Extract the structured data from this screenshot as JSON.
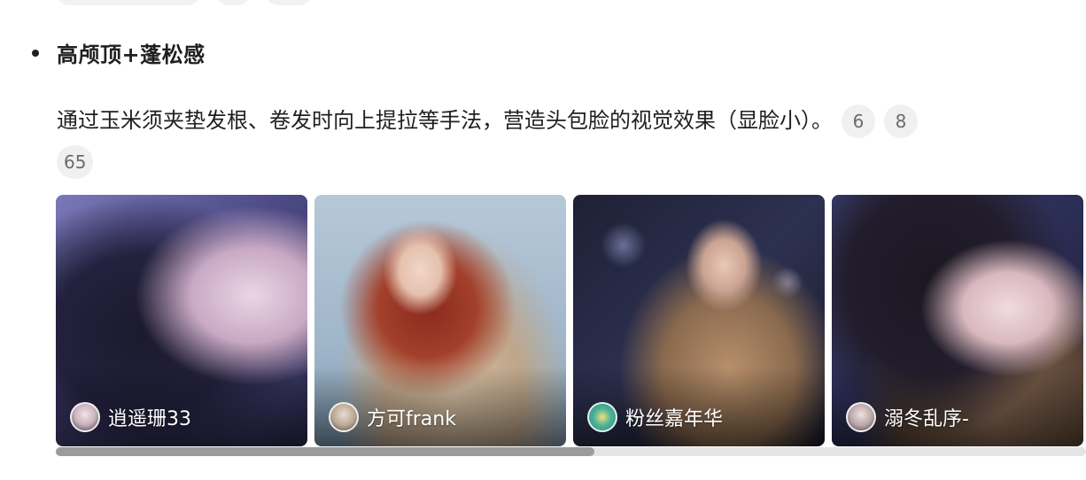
{
  "section": {
    "heading": "高颅顶+蓬松感",
    "paragraph": "通过玉米须夹垫发根、卷发时向上提拉等手法，营造头包脸的视觉效果（显脸小）。",
    "refs": [
      "6",
      "8",
      "65"
    ]
  },
  "gallery": {
    "cards": [
      {
        "username": "逍遥珊33",
        "avatar_icon": "user-avatar-icon"
      },
      {
        "username": "方可frank",
        "avatar_icon": "user-avatar-icon"
      },
      {
        "username": "粉丝嘉年华",
        "avatar_icon": "user-avatar-icon"
      },
      {
        "username": "溺冬乱序-",
        "avatar_icon": "user-avatar-icon"
      }
    ],
    "scroll_position": 0.52
  },
  "colors": {
    "text": "#1f1f1f",
    "ref_bg": "#f0f0f0",
    "ref_text": "#6b6b6b",
    "scroll_thumb": "#9b9b9b",
    "scroll_track": "#e4e4e4"
  }
}
